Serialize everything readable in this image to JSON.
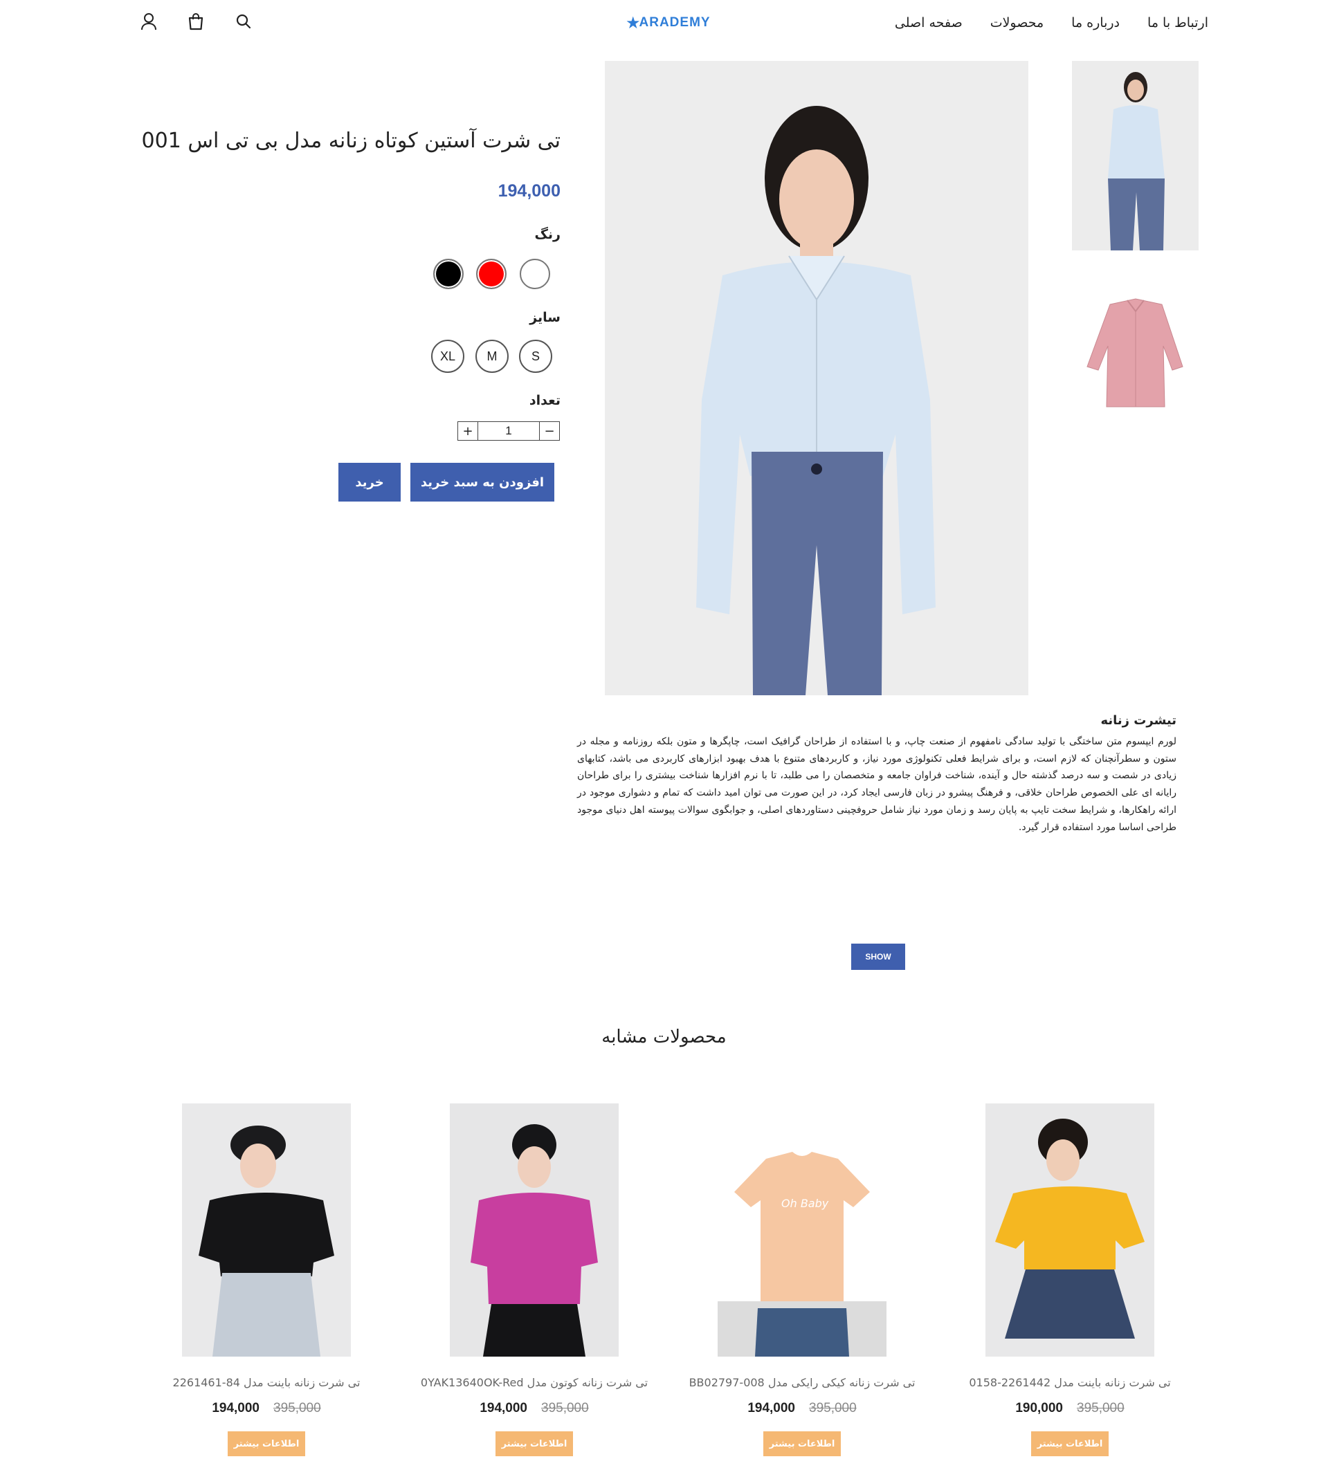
{
  "header": {
    "logo_text": "ARADEMY",
    "nav": [
      "صفحه اصلی",
      "محصولات",
      "درباره ما",
      "ارتباط با ما"
    ],
    "icons": [
      "user-icon",
      "shopping-bag-icon",
      "search-icon"
    ]
  },
  "product": {
    "title": "تی شرت آستین کوتاه زنانه مدل بی تی اس 001",
    "price": "194,000",
    "color_label": "رنگ",
    "colors": [
      "#000000",
      "#ff0000",
      "#ffffff"
    ],
    "size_label": "سایز",
    "sizes": [
      "XL",
      "M",
      "S"
    ],
    "quantity_label": "تعداد",
    "quantity": "1",
    "add_to_cart": "افزودن به سبد خرید",
    "buy": "خرید"
  },
  "description": {
    "title": "تیشرت زنانه",
    "text": "لورم ایپسوم متن ساختگی با تولید سادگی نامفهوم از صنعت چاپ، و با استفاده از طراحان گرافیک است، چاپگرها و متون بلکه روزنامه و مجله در ستون و سطرآنچنان که لازم است، و برای شرایط فعلی تکنولوژی مورد نیاز، و کاربردهای متنوع با هدف بهبود ابزارهای کاربردی می باشد، کتابهای زیادی در شصت و سه درصد گذشته حال و آینده، شناخت فراوان جامعه و متخصصان را می طلبد، تا با نرم افزارها شناخت بیشتری را برای طراحان رایانه ای علی الخصوص طراحان خلاقی، و فرهنگ پیشرو در زبان فارسی ایجاد کرد، در این صورت می توان امید داشت که تمام و دشواری موجود در ارائه راهکارها، و شرایط سخت تایپ به پایان رسد و زمان مورد نیاز شامل حروفچینی دستاوردهای اصلی، و جوابگوی سوالات پیوسته اهل دنیای موجود طراحی اساسا مورد استفاده قرار گیرد.",
    "show_button": "SHOW"
  },
  "similar": {
    "title": "محصولات مشابه",
    "products": [
      {
        "name": "تی شرت زنانه باینت مدل 84-2261461",
        "price": "194,000",
        "old_price": "395,000",
        "button": "اطلاعات بیشتر"
      },
      {
        "name": "تی شرت زنانه کوتون مدل 0YAK13640OK-Red",
        "price": "194,000",
        "old_price": "395,000",
        "button": "اطلاعات بیشتر"
      },
      {
        "name": "تی شرت زنانه کیکی رایکی مدل BB02797-008",
        "price": "194,000",
        "old_price": "395,000",
        "button": "اطلاعات بیشتر"
      },
      {
        "name": "تی شرت زنانه باینت مدل 2261442-0158",
        "price": "190,000",
        "old_price": "395,000",
        "button": "اطلاعات بیشتر"
      }
    ]
  }
}
